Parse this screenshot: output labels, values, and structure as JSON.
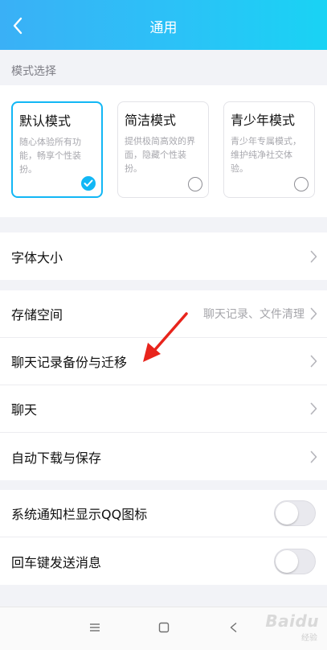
{
  "header": {
    "title": "通用",
    "back_icon": "chevron-left-icon"
  },
  "mode_section": {
    "label": "模式选择",
    "modes": [
      {
        "title": "默认模式",
        "desc": "随心体验所有功能，畅享个性装扮。",
        "selected": true
      },
      {
        "title": "简洁模式",
        "desc": "提供极简高效的界面，隐藏个性装扮。",
        "selected": false
      },
      {
        "title": "青少年模式",
        "desc": "青少年专属模式，维护纯净社交体验。",
        "selected": false
      }
    ]
  },
  "font_size": {
    "label": "字体大小"
  },
  "settings": {
    "storage": {
      "label": "存储空间",
      "value": "聊天记录、文件清理"
    },
    "backup": {
      "label": "聊天记录备份与迁移"
    },
    "chat": {
      "label": "聊天"
    },
    "auto_download": {
      "label": "自动下载与保存"
    }
  },
  "toggles": {
    "notification_icon": {
      "label": "系统通知栏显示QQ图标",
      "on": false
    },
    "enter_send": {
      "label": "回车键发送消息",
      "on": false
    }
  },
  "navbar": {
    "menu_icon": "menu-icon",
    "home_icon": "square-icon",
    "back_icon": "back-triangle-icon"
  },
  "watermark": {
    "text": "Baidu",
    "sub": "经验"
  },
  "colors": {
    "accent": "#12b7f5",
    "header_start": "#3ab0f6",
    "header_end": "#19d3f4",
    "annotation": "#e8241c"
  }
}
